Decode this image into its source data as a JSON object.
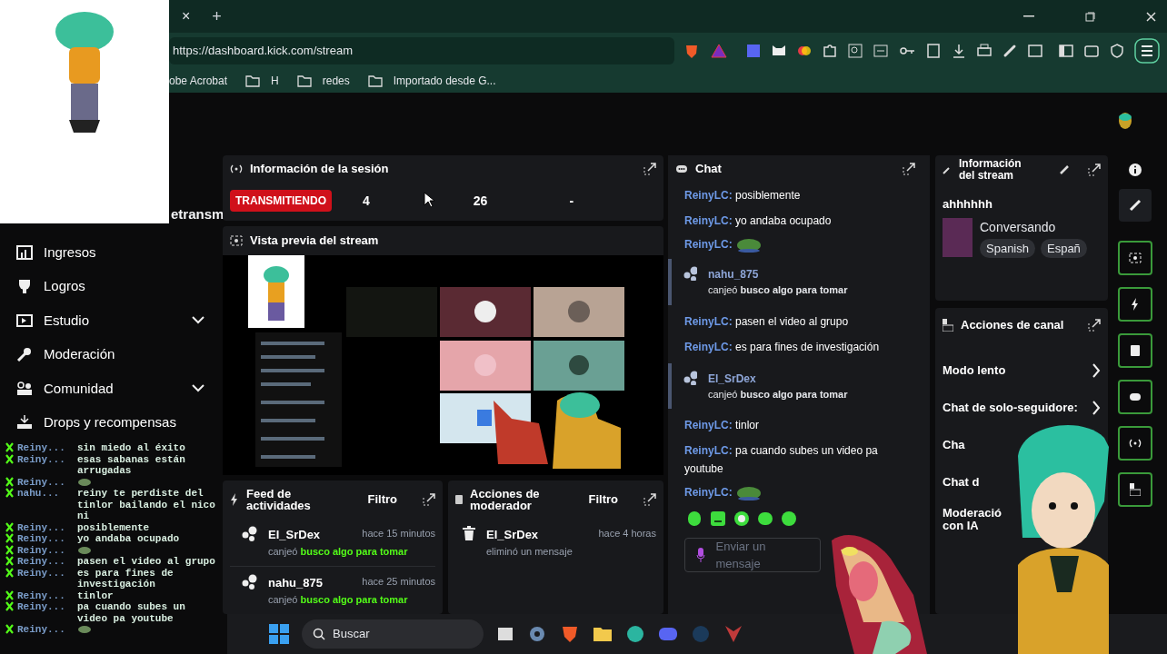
{
  "browser": {
    "tab_close": "×",
    "new_tab": "+",
    "url": "https://dashboard.kick.com/stream",
    "bookmarks": [
      {
        "label": "obe Acrobat",
        "folder": false
      },
      {
        "label": "H",
        "folder": true
      },
      {
        "label": "redes",
        "folder": true
      },
      {
        "label": "Importado desde G...",
        "folder": true
      }
    ]
  },
  "sidebar": {
    "cut_label": "etransm",
    "items": [
      {
        "label": "Ingresos",
        "chevron": false
      },
      {
        "label": "Logros",
        "chevron": false
      },
      {
        "label": "Estudio",
        "chevron": true
      },
      {
        "label": "Moderación",
        "chevron": false
      },
      {
        "label": "Comunidad",
        "chevron": true
      },
      {
        "label": "Drops y recompensas",
        "chevron": false
      }
    ]
  },
  "session": {
    "title": "Información de la sesión",
    "status": "TRANSMITIENDO",
    "stats": [
      "4",
      "26",
      "-"
    ]
  },
  "preview": {
    "title": "Vista previa del stream"
  },
  "activity_feed": {
    "title": "Feed de actividades",
    "filter": "Filtro",
    "items": [
      {
        "user": "El_SrDex",
        "time": "hace 15 minutos",
        "action": "canjeó",
        "reward": "busco algo para tomar"
      },
      {
        "user": "nahu_875",
        "time": "hace 25 minutos",
        "action": "canjeó",
        "reward": "busco algo para tomar"
      }
    ]
  },
  "mod_actions": {
    "title": "Acciones de moderador",
    "filter": "Filtro",
    "items": [
      {
        "user": "El_SrDex",
        "time": "hace 4 horas",
        "action": "eliminó un mensaje"
      }
    ]
  },
  "chat": {
    "title": "Chat",
    "messages": [
      {
        "kind": "text",
        "user": "ReinyLC:",
        "text": "posiblemente"
      },
      {
        "kind": "text",
        "user": "ReinyLC:",
        "text": "yo andaba ocupado"
      },
      {
        "kind": "emote",
        "user": "ReinyLC:"
      },
      {
        "kind": "redeem",
        "user": "nahu_875",
        "action": "canjeó",
        "reward": "busco algo para tomar"
      },
      {
        "kind": "text",
        "user": "ReinyLC:",
        "text": "pasen el video al grupo"
      },
      {
        "kind": "text",
        "user": "ReinyLC:",
        "text": "es para fines de investigación"
      },
      {
        "kind": "redeem",
        "user": "El_SrDex",
        "action": "canjeó",
        "reward": "busco algo para tomar"
      },
      {
        "kind": "text",
        "user": "ReinyLC:",
        "text": "tinlor"
      },
      {
        "kind": "text",
        "user": "ReinyLC:",
        "text": "pa cuando subes un video pa youtube"
      },
      {
        "kind": "emote",
        "user": "ReinyLC:"
      }
    ],
    "placeholder": "Enviar un mensaje"
  },
  "stream_info": {
    "title": "Información del stream",
    "stream_title": "ahhhhhh",
    "category": "Conversando",
    "tags": [
      "Spanish",
      "Españ"
    ]
  },
  "channel_actions": {
    "title": "Acciones de canal",
    "items": [
      {
        "label": "Modo lento",
        "chevron": true
      },
      {
        "label": "Chat de solo-seguidore:",
        "chevron": true
      },
      {
        "label": "Cha",
        "chevron": false
      },
      {
        "label": "Chat d",
        "chevron": false
      },
      {
        "label": "Moderació con IA",
        "chevron": false
      }
    ]
  },
  "overlay_chat": [
    {
      "kind": "text",
      "user": "Reiny...",
      "text": "sin miedo al éxito"
    },
    {
      "kind": "text",
      "user": "Reiny...",
      "text": "esas sabanas están arrugadas"
    },
    {
      "kind": "emote",
      "user": "Reiny..."
    },
    {
      "kind": "text",
      "user": "nahu...",
      "text": "reiny te perdiste del tinlor bailando el nico ni"
    },
    {
      "kind": "text",
      "user": "Reiny...",
      "text": "posiblemente"
    },
    {
      "kind": "text",
      "user": "Reiny...",
      "text": "yo andaba ocupado"
    },
    {
      "kind": "emote",
      "user": "Reiny..."
    },
    {
      "kind": "text",
      "user": "Reiny...",
      "text": "pasen el video al grupo"
    },
    {
      "kind": "text",
      "user": "Reiny...",
      "text": "es para fines de investigación"
    },
    {
      "kind": "text",
      "user": "Reiny...",
      "text": "tinlor"
    },
    {
      "kind": "text",
      "user": "Reiny...",
      "text": "pa cuando subes un video pa youtube"
    },
    {
      "kind": "emote",
      "user": "Reiny..."
    }
  ],
  "taskbar": {
    "search": "Buscar"
  }
}
